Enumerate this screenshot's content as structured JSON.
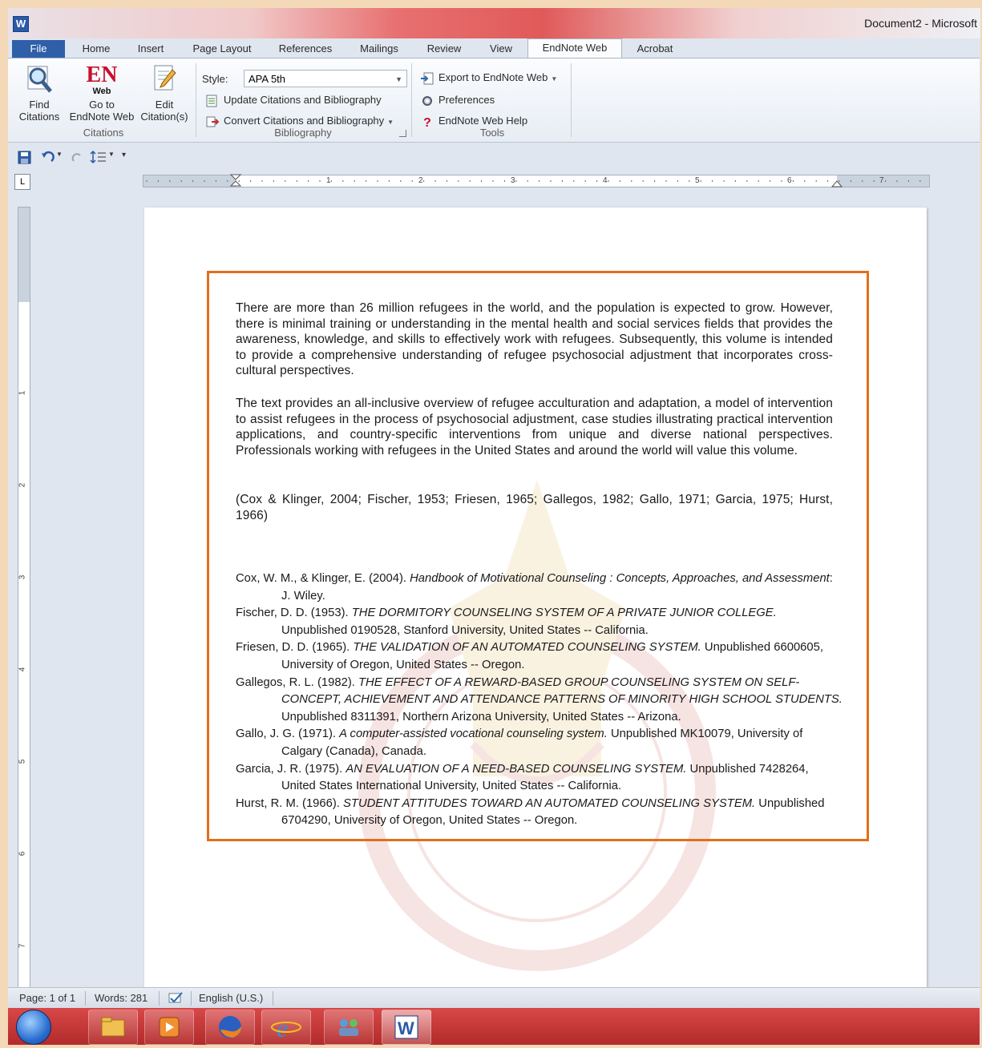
{
  "window": {
    "app_letter": "W",
    "title": "Document2 - Microsoft"
  },
  "tabs": [
    {
      "label": "File"
    },
    {
      "label": "Home"
    },
    {
      "label": "Insert"
    },
    {
      "label": "Page Layout"
    },
    {
      "label": "References"
    },
    {
      "label": "Mailings"
    },
    {
      "label": "Review"
    },
    {
      "label": "View"
    },
    {
      "label": "EndNote Web"
    },
    {
      "label": "Acrobat"
    }
  ],
  "ribbon": {
    "citations": {
      "find_label": "Find\nCitations",
      "goto_label": "Go to\nEndNote Web",
      "edit_label": "Edit\nCitation(s)",
      "logo_text": "EN",
      "logo_sub": "Web",
      "group_label": "Citations"
    },
    "bibliography": {
      "style_label": "Style:",
      "style_value": "APA 5th",
      "update_label": "Update Citations and Bibliography",
      "convert_label": "Convert Citations and Bibliography",
      "group_label": "Bibliography"
    },
    "tools": {
      "export_label": "Export to EndNote Web",
      "preferences_label": "Preferences",
      "help_label": "EndNote Web Help",
      "group_label": "Tools"
    }
  },
  "ruler": {
    "tab_selector": "L",
    "h_numbers": [
      "1",
      "2",
      "3",
      "4",
      "5",
      "6",
      "7"
    ],
    "v_numbers": [
      "1",
      "2",
      "3",
      "4",
      "5",
      "6",
      "7"
    ]
  },
  "document": {
    "paragraph1": "There are more than 26 million refugees in the world, and the population is expected to grow. However, there is minimal training or understanding in the mental health and social services fields that provides the awareness, knowledge, and skills to effectively work with refugees. Subsequently, this volume is intended to provide a comprehensive understanding of refugee psychosocial adjustment that incorporates cross-cultural perspectives.",
    "paragraph2": "The text provides an all-inclusive overview of refugee acculturation and adaptation, a model of intervention to assist refugees in the process of psychosocial adjustment, case studies illustrating practical intervention applications, and country-specific interventions from unique and diverse national perspectives. Professionals working with refugees in the United States and around the world will value this volume.",
    "citations": "(Cox & Klinger, 2004; Fischer, 1953; Friesen, 1965; Gallegos, 1982; Gallo, 1971; Garcia, 1975; Hurst, 1966)",
    "references": [
      {
        "authors": "Cox, W. M., & Klinger, E. (2004). ",
        "title": "Handbook of Motivational Counseling : Concepts, Approaches, and Assessment",
        "rest": ": J. Wiley."
      },
      {
        "authors": "Fischer, D. D. (1953). ",
        "title": "THE DORMITORY COUNSELING SYSTEM OF A PRIVATE JUNIOR COLLEGE.",
        "rest": " Unpublished 0190528, Stanford University, United States -- California."
      },
      {
        "authors": "Friesen, D. D. (1965). ",
        "title": "THE VALIDATION OF AN AUTOMATED COUNSELING SYSTEM.",
        "rest": " Unpublished 6600605, University of Oregon, United States -- Oregon."
      },
      {
        "authors": "Gallegos, R. L. (1982). ",
        "title": "THE EFFECT OF A REWARD-BASED GROUP COUNSELING SYSTEM ON SELF-CONCEPT, ACHIEVEMENT AND ATTENDANCE PATTERNS OF MINORITY HIGH SCHOOL STUDENTS.",
        "rest": " Unpublished 8311391, Northern Arizona University, United States -- Arizona."
      },
      {
        "authors": "Gallo, J. G. (1971). ",
        "title": "A computer-assisted vocational counseling system.",
        "rest": " Unpublished MK10079, University of Calgary (Canada), Canada."
      },
      {
        "authors": "Garcia, J. R. (1975). ",
        "title": "AN EVALUATION OF A NEED-BASED COUNSELING SYSTEM.",
        "rest": " Unpublished 7428264, United States International University, United States -- California."
      },
      {
        "authors": "Hurst, R. M. (1966). ",
        "title": "STUDENT ATTITUDES TOWARD AN AUTOMATED COUNSELING SYSTEM.",
        "rest": " Unpublished 6704290, University of Oregon, United States -- Oregon."
      }
    ]
  },
  "status": {
    "page": "Page: 1 of 1",
    "words": "Words: 281",
    "language": "English (U.S.)"
  },
  "colors": {
    "highlight_box": "#e0701c",
    "file_tab": "#2f5fa8",
    "taskbar": "#c23434"
  },
  "taskbar_icons": [
    "start-orb-icon",
    "explorer-icon",
    "media-player-icon",
    "firefox-icon",
    "internet-explorer-icon",
    "network-icon",
    "word-icon"
  ]
}
